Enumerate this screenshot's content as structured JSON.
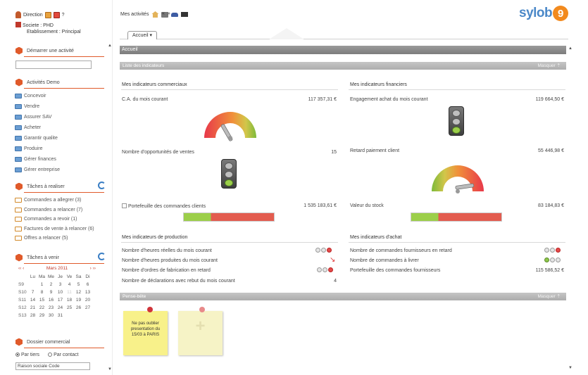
{
  "user": {
    "name": "Direction",
    "help": "?"
  },
  "company": {
    "label": "Societe : PHD",
    "etablissement": "Etablissement : Principal"
  },
  "sidebar": {
    "start_activity": {
      "title": "Démarrer une activité",
      "input_value": ""
    },
    "demo": {
      "title": "Activités Demo",
      "items": [
        {
          "label": "Concevoir"
        },
        {
          "label": "Vendre"
        },
        {
          "label": "Assurer SAV"
        },
        {
          "label": "Acheter"
        },
        {
          "label": "Garantir qualite"
        },
        {
          "label": "Produire"
        },
        {
          "label": "Gérer finances"
        },
        {
          "label": "Gérer entreprise"
        }
      ]
    },
    "tasks_todo": {
      "title": "Tâches à realiser",
      "items": [
        {
          "label": "Commandes a allegrer (3)"
        },
        {
          "label": "Commandes a relancer (7)"
        },
        {
          "label": "Commandes a revoir (1)"
        },
        {
          "label": "Factures de vente à relancer (6)"
        },
        {
          "label": "Offres a relancer (5)"
        }
      ]
    },
    "tasks_upcoming": {
      "title": "Tâches à venir",
      "calendar": {
        "prev": "‹‹ ‹",
        "month": "Mars 2011",
        "next": "› ››",
        "days": [
          "Lu",
          "Ma",
          "Me",
          "Je",
          "Ve",
          "Sa",
          "Di"
        ],
        "weeks": [
          {
            "wk": "S9",
            "d": [
              "",
              "1",
              "2",
              "3",
              "4",
              "5",
              "6"
            ]
          },
          {
            "wk": "S10",
            "d": [
              "7",
              "8",
              "9",
              "10",
              "11",
              "12",
              "13"
            ]
          },
          {
            "wk": "S11",
            "d": [
              "14",
              "15",
              "16",
              "17",
              "18",
              "19",
              "20"
            ]
          },
          {
            "wk": "S12",
            "d": [
              "21",
              "22",
              "23",
              "24",
              "25",
              "26",
              "27"
            ]
          },
          {
            "wk": "S13",
            "d": [
              "28",
              "29",
              "30",
              "31",
              "",
              "",
              ""
            ]
          }
        ]
      }
    },
    "commercial_file": {
      "title": "Dossier commercial",
      "radio_tiers": "Par tiers",
      "radio_contact": "Par contact",
      "input_value": "Raison sociale Code"
    }
  },
  "topbar": {
    "activities_label": "Mes activités",
    "nav_arrows": "«  »",
    "tab_label": "Accueil",
    "logo_text": "sylob",
    "logo_number": "9"
  },
  "main": {
    "accueil_title": "Accueil",
    "indicators_panel": {
      "title": "Liste des indicateurs",
      "action": "Masquer",
      "commercial": {
        "title": "Mes indicateurs commerciaux",
        "rows": [
          {
            "label": "C.A. du mois courant",
            "value": "117 357,31 €"
          },
          {
            "label": "Nombre d'opportunités de ventes",
            "value": "15"
          },
          {
            "label": "Portefeuille des commandes clients",
            "value": "1 535 183,61 €"
          }
        ]
      },
      "financial": {
        "title": "Mes indicateurs financiers",
        "rows": [
          {
            "label": "Engagement achat du mois courant",
            "value": "119 664,50 €"
          },
          {
            "label": "Retard paiement client",
            "value": "55 446,98 €"
          },
          {
            "label": "Valeur du stock",
            "value": "83 184,83 €"
          }
        ]
      },
      "production": {
        "title": "Mes indicateurs de production",
        "rows": [
          {
            "label": "Nombre d'heures réelles du mois courant"
          },
          {
            "label": "Nombre d'heures produites du mois courant"
          },
          {
            "label": "Nombre d'ordres de fabrication en retard"
          },
          {
            "label": "Nombre de déclarations avec rebut du mois courant",
            "value": "4"
          }
        ]
      },
      "purchase": {
        "title": "Mes indicateurs d'achat",
        "rows": [
          {
            "label": "Nombre de commandes fournisseurs en retard"
          },
          {
            "label": "Nombre de commandes à livrer"
          },
          {
            "label": "Portefeuille des commandes fournisseurs",
            "value": "115 586,52 €"
          }
        ]
      }
    },
    "notes_panel": {
      "title": "Pense-bête",
      "action": "Masquer",
      "note_text": "Ne pas oublier presentation du 15/03 à PARIS"
    }
  },
  "colors": {
    "accent_orange": "#e05a2a",
    "brand_blue": "#4b88c8",
    "brand_orange": "#f28a1e",
    "gauge_green": "#8fc64a",
    "gauge_red": "#e24a4a"
  }
}
